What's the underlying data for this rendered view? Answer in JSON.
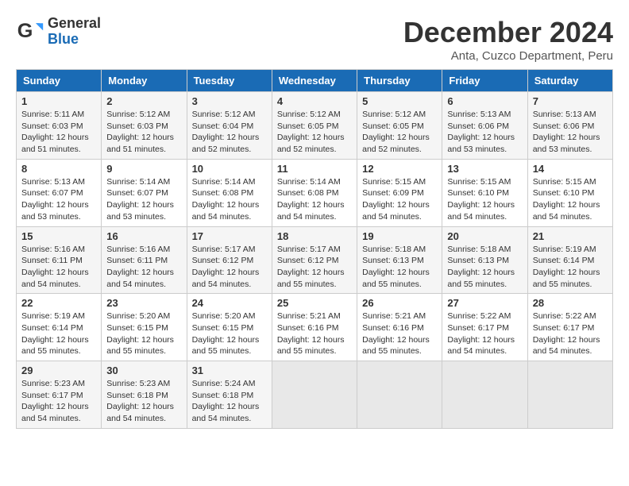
{
  "logo": {
    "general": "General",
    "blue": "Blue"
  },
  "title": "December 2024",
  "location": "Anta, Cuzco Department, Peru",
  "days_of_week": [
    "Sunday",
    "Monday",
    "Tuesday",
    "Wednesday",
    "Thursday",
    "Friday",
    "Saturday"
  ],
  "weeks": [
    [
      {
        "day": "1",
        "sunrise": "5:11 AM",
        "sunset": "6:03 PM",
        "daylight": "12 hours and 51 minutes."
      },
      {
        "day": "2",
        "sunrise": "5:12 AM",
        "sunset": "6:03 PM",
        "daylight": "12 hours and 51 minutes."
      },
      {
        "day": "3",
        "sunrise": "5:12 AM",
        "sunset": "6:04 PM",
        "daylight": "12 hours and 52 minutes."
      },
      {
        "day": "4",
        "sunrise": "5:12 AM",
        "sunset": "6:05 PM",
        "daylight": "12 hours and 52 minutes."
      },
      {
        "day": "5",
        "sunrise": "5:12 AM",
        "sunset": "6:05 PM",
        "daylight": "12 hours and 52 minutes."
      },
      {
        "day": "6",
        "sunrise": "5:13 AM",
        "sunset": "6:06 PM",
        "daylight": "12 hours and 53 minutes."
      },
      {
        "day": "7",
        "sunrise": "5:13 AM",
        "sunset": "6:06 PM",
        "daylight": "12 hours and 53 minutes."
      }
    ],
    [
      {
        "day": "8",
        "sunrise": "5:13 AM",
        "sunset": "6:07 PM",
        "daylight": "12 hours and 53 minutes."
      },
      {
        "day": "9",
        "sunrise": "5:14 AM",
        "sunset": "6:07 PM",
        "daylight": "12 hours and 53 minutes."
      },
      {
        "day": "10",
        "sunrise": "5:14 AM",
        "sunset": "6:08 PM",
        "daylight": "12 hours and 54 minutes."
      },
      {
        "day": "11",
        "sunrise": "5:14 AM",
        "sunset": "6:08 PM",
        "daylight": "12 hours and 54 minutes."
      },
      {
        "day": "12",
        "sunrise": "5:15 AM",
        "sunset": "6:09 PM",
        "daylight": "12 hours and 54 minutes."
      },
      {
        "day": "13",
        "sunrise": "5:15 AM",
        "sunset": "6:10 PM",
        "daylight": "12 hours and 54 minutes."
      },
      {
        "day": "14",
        "sunrise": "5:15 AM",
        "sunset": "6:10 PM",
        "daylight": "12 hours and 54 minutes."
      }
    ],
    [
      {
        "day": "15",
        "sunrise": "5:16 AM",
        "sunset": "6:11 PM",
        "daylight": "12 hours and 54 minutes."
      },
      {
        "day": "16",
        "sunrise": "5:16 AM",
        "sunset": "6:11 PM",
        "daylight": "12 hours and 54 minutes."
      },
      {
        "day": "17",
        "sunrise": "5:17 AM",
        "sunset": "6:12 PM",
        "daylight": "12 hours and 54 minutes."
      },
      {
        "day": "18",
        "sunrise": "5:17 AM",
        "sunset": "6:12 PM",
        "daylight": "12 hours and 55 minutes."
      },
      {
        "day": "19",
        "sunrise": "5:18 AM",
        "sunset": "6:13 PM",
        "daylight": "12 hours and 55 minutes."
      },
      {
        "day": "20",
        "sunrise": "5:18 AM",
        "sunset": "6:13 PM",
        "daylight": "12 hours and 55 minutes."
      },
      {
        "day": "21",
        "sunrise": "5:19 AM",
        "sunset": "6:14 PM",
        "daylight": "12 hours and 55 minutes."
      }
    ],
    [
      {
        "day": "22",
        "sunrise": "5:19 AM",
        "sunset": "6:14 PM",
        "daylight": "12 hours and 55 minutes."
      },
      {
        "day": "23",
        "sunrise": "5:20 AM",
        "sunset": "6:15 PM",
        "daylight": "12 hours and 55 minutes."
      },
      {
        "day": "24",
        "sunrise": "5:20 AM",
        "sunset": "6:15 PM",
        "daylight": "12 hours and 55 minutes."
      },
      {
        "day": "25",
        "sunrise": "5:21 AM",
        "sunset": "6:16 PM",
        "daylight": "12 hours and 55 minutes."
      },
      {
        "day": "26",
        "sunrise": "5:21 AM",
        "sunset": "6:16 PM",
        "daylight": "12 hours and 55 minutes."
      },
      {
        "day": "27",
        "sunrise": "5:22 AM",
        "sunset": "6:17 PM",
        "daylight": "12 hours and 54 minutes."
      },
      {
        "day": "28",
        "sunrise": "5:22 AM",
        "sunset": "6:17 PM",
        "daylight": "12 hours and 54 minutes."
      }
    ],
    [
      {
        "day": "29",
        "sunrise": "5:23 AM",
        "sunset": "6:17 PM",
        "daylight": "12 hours and 54 minutes."
      },
      {
        "day": "30",
        "sunrise": "5:23 AM",
        "sunset": "6:18 PM",
        "daylight": "12 hours and 54 minutes."
      },
      {
        "day": "31",
        "sunrise": "5:24 AM",
        "sunset": "6:18 PM",
        "daylight": "12 hours and 54 minutes."
      },
      null,
      null,
      null,
      null
    ]
  ]
}
